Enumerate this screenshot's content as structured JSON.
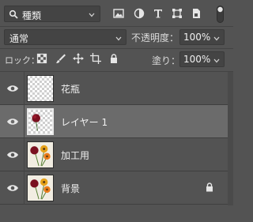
{
  "filter": {
    "kind_label": "種類"
  },
  "blend": {
    "mode": "通常"
  },
  "opacity": {
    "label": "不透明度：",
    "value": "100%"
  },
  "lock": {
    "label": "ロック："
  },
  "fill": {
    "label": "塗り：",
    "value": "100%"
  },
  "layers": [
    {
      "name": "花瓶",
      "thumbnail": "transparent",
      "locked": false,
      "selected": false
    },
    {
      "name": "レイヤー 1",
      "thumbnail": "flower-on-transparent",
      "locked": false,
      "selected": true
    },
    {
      "name": "加工用",
      "thumbnail": "flowers-photo",
      "locked": false,
      "selected": false
    },
    {
      "name": "背景",
      "thumbnail": "flowers-photo",
      "locked": true,
      "selected": false
    }
  ],
  "colors": {
    "panel": "#535353",
    "selected_row": "#6b6b6b",
    "field": "#444444"
  }
}
